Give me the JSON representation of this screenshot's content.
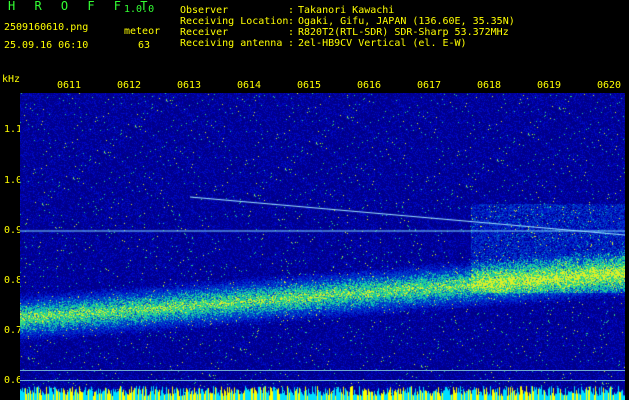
{
  "header": {
    "app_title": "H R O F F T",
    "version": "1.0.0",
    "filename": "2509160610.png",
    "datetime": "25.09.16 06:10",
    "meteor_label": "meteor",
    "meteor_count": "63",
    "info": [
      {
        "key": "Observer",
        "value": "Takanori Kawachi"
      },
      {
        "key": "Receiving Location",
        "value": "Ogaki, Gifu, JAPAN (136.60E, 35.35N)"
      },
      {
        "key": "Receiver",
        "value": "R820T2(RTL-SDR) SDR-Sharp 53.372MHz"
      },
      {
        "key": "Receiving antenna",
        "value": "2el-HB9CV Vertical (el. E-W)"
      }
    ]
  },
  "axis": {
    "y_unit": "kHz",
    "y_ticks": [
      "1.1",
      "1.0",
      "0.9",
      "0.8",
      "0.7",
      "0.6"
    ],
    "x_ticks": [
      "0611",
      "0612",
      "0613",
      "0614",
      "0615",
      "0616",
      "0617",
      "0618",
      "0619",
      "0620"
    ]
  },
  "colors": {
    "background": "#000000",
    "header_green": "#33ff33",
    "header_yellow": "#ffff00",
    "spectrogram_base": "#00006e",
    "signal_cyan": "#00e0ff",
    "signal_yellow": "#ffff00"
  }
}
